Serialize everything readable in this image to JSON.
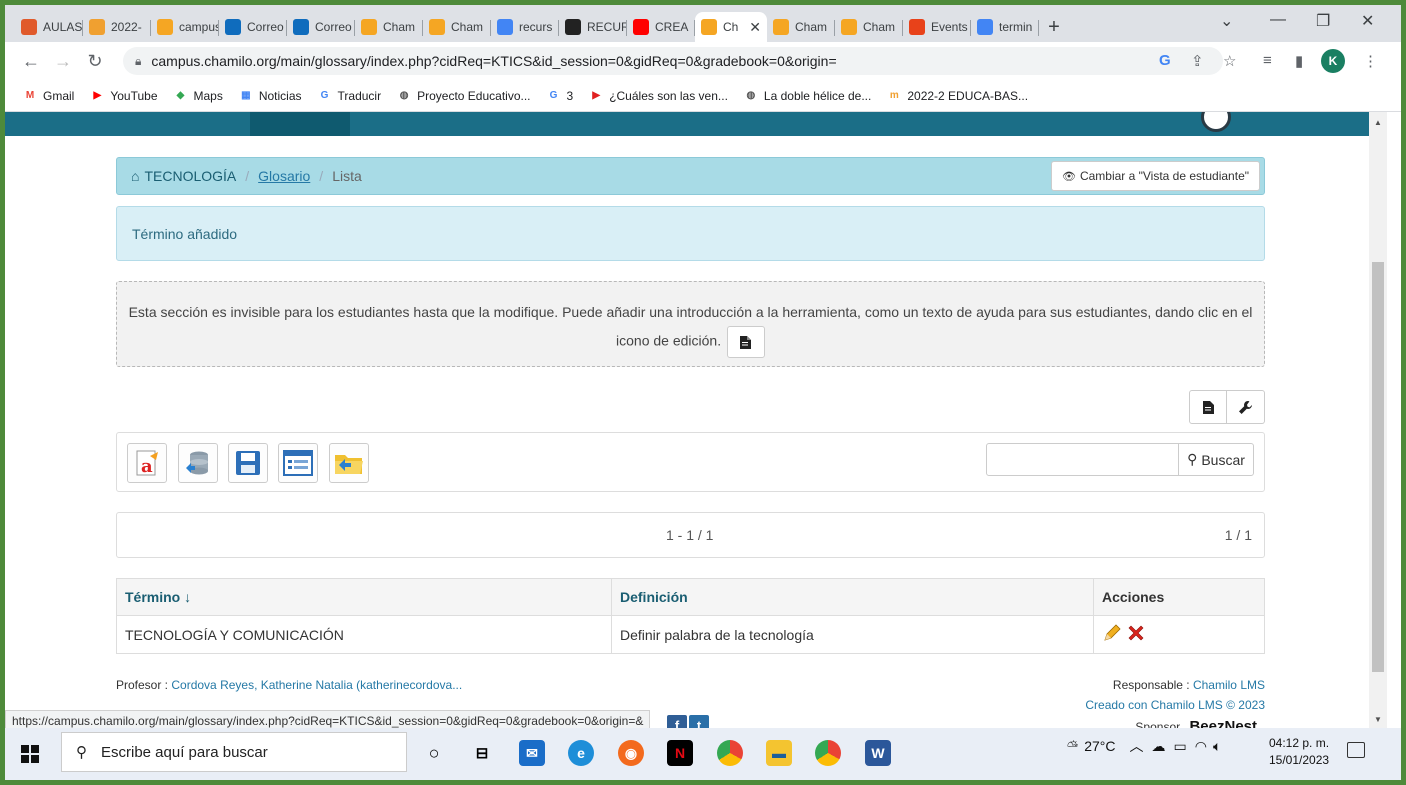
{
  "browser": {
    "tabs": [
      {
        "label": "AULAS",
        "icon": "joomla-icon",
        "color": "#e05a2b"
      },
      {
        "label": "2022-",
        "icon": "moodle-icon",
        "color": "#f0a030"
      },
      {
        "label": "campus",
        "icon": "chamilo-icon",
        "color": "#f5a623"
      },
      {
        "label": "Correo",
        "icon": "outlook-icon",
        "color": "#0f6cbd"
      },
      {
        "label": "Correo",
        "icon": "outlook-icon",
        "color": "#0f6cbd"
      },
      {
        "label": "Cham",
        "icon": "chamilo-icon",
        "color": "#f5a623"
      },
      {
        "label": "Cham",
        "icon": "chamilo-icon",
        "color": "#f5a623"
      },
      {
        "label": "recurs",
        "icon": "google-icon",
        "color": "#4285f4"
      },
      {
        "label": "RECUR",
        "icon": "recur-icon",
        "color": "#222222"
      },
      {
        "label": "CREA",
        "icon": "youtube-icon",
        "color": "#ff0000"
      },
      {
        "label": "Ch",
        "icon": "chamilo-icon",
        "color": "#f5a623",
        "active": true
      },
      {
        "label": "Cham",
        "icon": "chamilo-icon",
        "color": "#f5a623"
      },
      {
        "label": "Cham",
        "icon": "chamilo-icon",
        "color": "#f5a623"
      },
      {
        "label": "Events",
        "icon": "events-icon",
        "color": "#e8421a"
      },
      {
        "label": "termin",
        "icon": "google-icon",
        "color": "#4285f4"
      }
    ],
    "url": "campus.chamilo.org/main/glossary/index.php?cidReq=KTICS&id_session=0&gidReq=0&gradebook=0&origin=",
    "profile_initial": "K",
    "bookmarks": [
      {
        "label": "Gmail",
        "icon": "gmail-icon",
        "color": "#ea4335",
        "glyph": "M"
      },
      {
        "label": "YouTube",
        "icon": "youtube-icon",
        "color": "#ff0000",
        "glyph": "▶"
      },
      {
        "label": "Maps",
        "icon": "maps-icon",
        "color": "#34a853",
        "glyph": "◆"
      },
      {
        "label": "Noticias",
        "icon": "news-icon",
        "color": "#4285f4",
        "glyph": "▦"
      },
      {
        "label": "Traducir",
        "icon": "translate-icon",
        "color": "#4285f4",
        "glyph": "G"
      },
      {
        "label": "Proyecto Educativo...",
        "icon": "globe-icon",
        "color": "#555555",
        "glyph": "◍"
      },
      {
        "label": "3",
        "icon": "google-icon",
        "color": "#4285f4",
        "glyph": "G"
      },
      {
        "label": "¿Cuáles son las ven...",
        "icon": "arrow-icon",
        "color": "#e02020",
        "glyph": "▶"
      },
      {
        "label": "La doble hélice de...",
        "icon": "globe-icon",
        "color": "#555555",
        "glyph": "◍"
      },
      {
        "label": "2022-2 EDUCA-BAS...",
        "icon": "moodle-icon",
        "color": "#f0a030",
        "glyph": "m"
      }
    ],
    "status_url": "https://campus.chamilo.org/main/glossary/index.php?cidReq=KTICS&id_session=0&gidReq=0&gradebook=0&origin=&"
  },
  "page": {
    "breadcrumb": {
      "course": "TECNOLOGÍA",
      "section": "Glosario",
      "current": "Lista"
    },
    "student_view_button": "Cambiar a \"Vista de estudiante\"",
    "alert": "Término añadido",
    "intro_text": "Esta sección es invisible para los estudiantes hasta que la modifique. Puede añadir una introducción a la herramienta, como un texto de ayuda para sus estudiantes, dando clic en el icono de edición.",
    "search": {
      "placeholder": "",
      "button": "Buscar"
    },
    "pager": {
      "range": "1 - 1 / 1",
      "pages": "1 / 1"
    },
    "table": {
      "headers": {
        "term": "Término ↓",
        "definition": "Definición",
        "actions": "Acciones"
      },
      "rows": [
        {
          "term": "TECNOLOGÍA Y COMUNICACIÓN",
          "definition": "Definir palabra de la tecnología"
        }
      ]
    },
    "footer": {
      "teacher_label": "Profesor :",
      "teacher_name": "Cordova Reyes, Katherine Natalia (katherinecordova...",
      "responsible_label": "Responsable :",
      "responsible_name": "Chamilo LMS",
      "created_with": "Creado con Chamilo LMS © 2023",
      "sponsor_label": "Sponsor",
      "sponsor_name": "BeezNest"
    }
  },
  "taskbar": {
    "search_placeholder": "Escribe aquí para buscar",
    "temperature": "27°C",
    "time": "04:12 p. m.",
    "date": "15/01/2023"
  }
}
